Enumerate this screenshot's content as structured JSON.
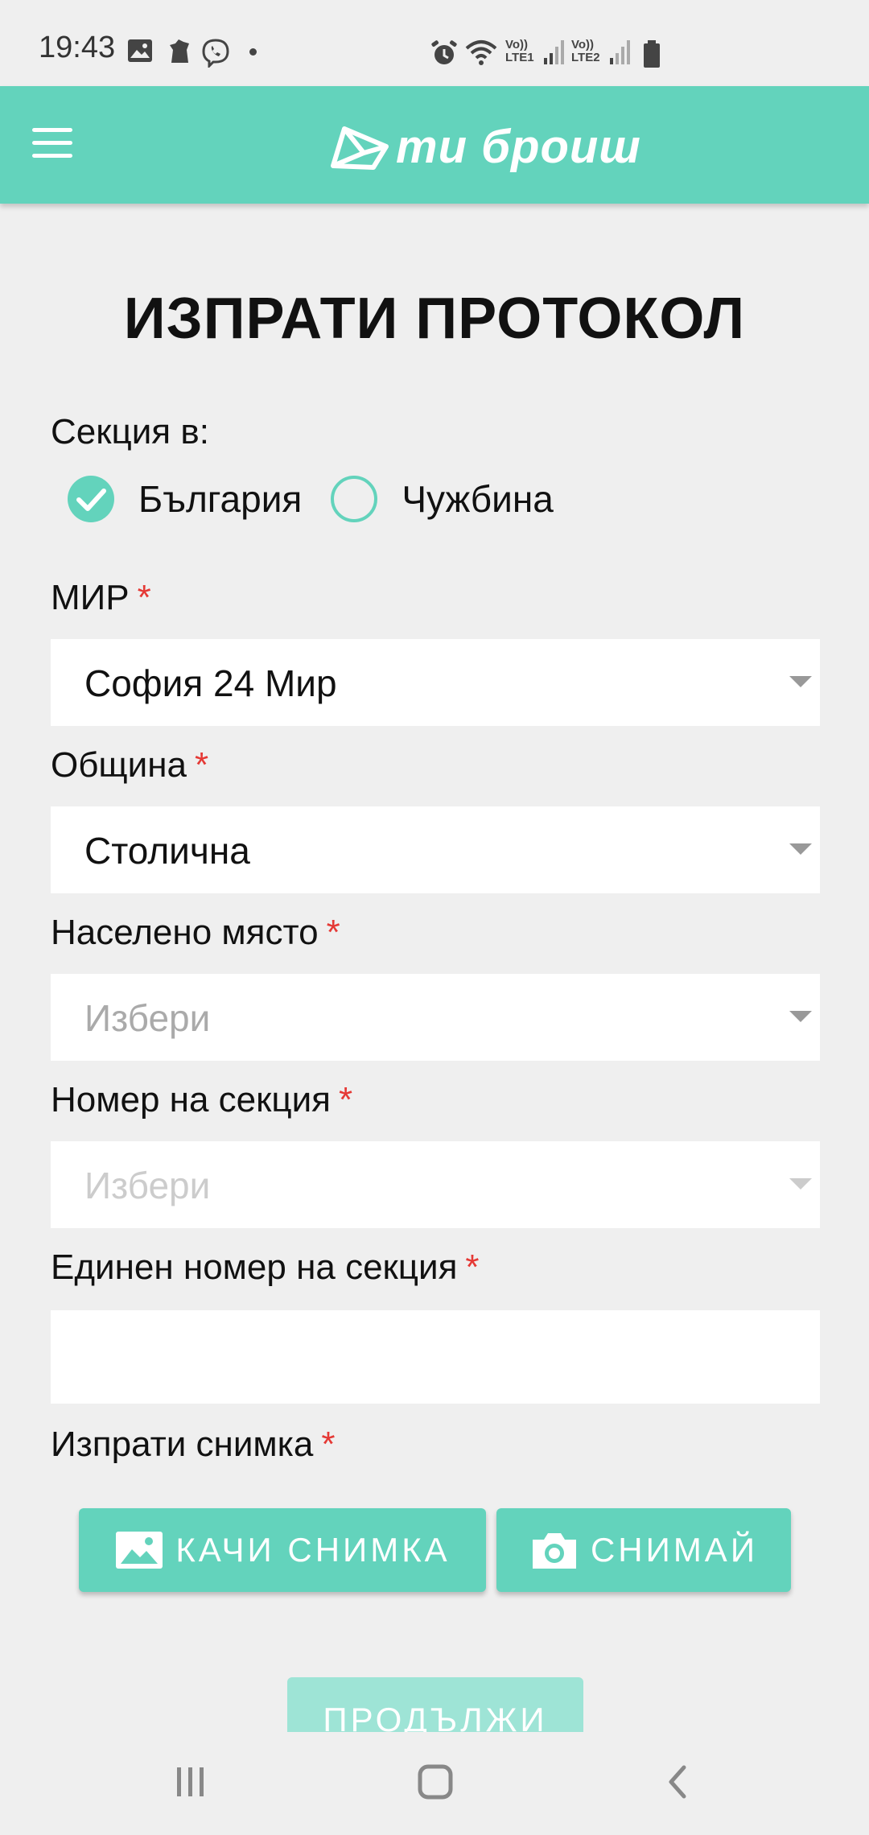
{
  "status_bar": {
    "time": "19:43",
    "sim1": "LTE1",
    "sim2": "LTE2",
    "volte": "Vo))"
  },
  "app_bar": {
    "logo_text": "ти броиш"
  },
  "page": {
    "title": "ИЗПРАТИ ПРОТОКОЛ"
  },
  "form": {
    "section_label": "Секция в:",
    "radio_bulgaria": "България",
    "radio_abroad": "Чужбина",
    "mir_label": "МИР",
    "mir_value": "София 24 Мир",
    "municipality_label": "Община",
    "municipality_value": "Столична",
    "settlement_label": "Населено място",
    "settlement_placeholder": "Избери",
    "section_number_label": "Номер на секция",
    "section_number_placeholder": "Избери",
    "unique_number_label": "Единен номер на секция",
    "unique_number_value": "",
    "photo_label": "Изпрати снимка",
    "required_mark": "*",
    "upload_button": "КАЧИ СНИМКА",
    "camera_button": "СНИМАЙ",
    "continue_button": "ПРОДЪЛЖИ"
  },
  "colors": {
    "accent": "#63d3bc",
    "required": "#e53935",
    "background": "#efefef"
  }
}
